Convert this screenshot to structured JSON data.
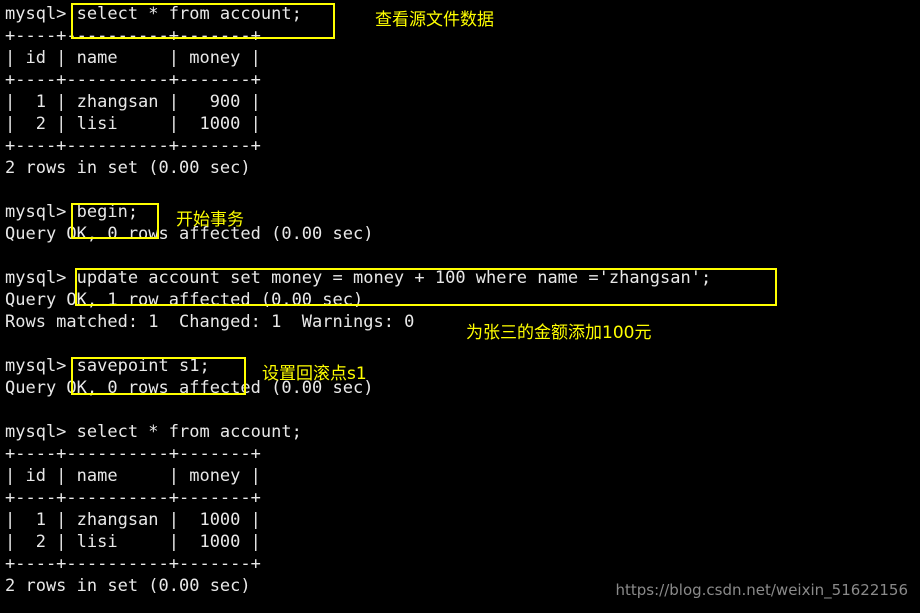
{
  "terminal": {
    "background_color": "#000000",
    "text_color": "#e8e8e8",
    "highlight_color": "#ffff00",
    "prompt": "mysql>",
    "lines": [
      {
        "id": "l0",
        "text": "mysql> select * from account;"
      },
      {
        "id": "l1",
        "text": "+----+----------+-------+"
      },
      {
        "id": "l2",
        "text": "| id | name     | money |"
      },
      {
        "id": "l3",
        "text": "+----+----------+-------+"
      },
      {
        "id": "l4",
        "text": "|  1 | zhangsan |   900 |"
      },
      {
        "id": "l5",
        "text": "|  2 | lisi     |  1000 |"
      },
      {
        "id": "l6",
        "text": "+----+----------+-------+"
      },
      {
        "id": "l7",
        "text": "2 rows in set (0.00 sec)"
      },
      {
        "id": "l8",
        "text": ""
      },
      {
        "id": "l9",
        "text": "mysql> begin;"
      },
      {
        "id": "l10",
        "text": "Query OK, 0 rows affected (0.00 sec)"
      },
      {
        "id": "l11",
        "text": ""
      },
      {
        "id": "l12",
        "text": "mysql> update account set money = money + 100 where name ='zhangsan';"
      },
      {
        "id": "l13",
        "text": "Query OK, 1 row affected (0.00 sec)"
      },
      {
        "id": "l14",
        "text": "Rows matched: 1  Changed: 1  Warnings: 0"
      },
      {
        "id": "l15",
        "text": ""
      },
      {
        "id": "l16",
        "text": "mysql> savepoint s1;"
      },
      {
        "id": "l17",
        "text": "Query OK, 0 rows affected (0.00 sec)"
      },
      {
        "id": "l18",
        "text": ""
      },
      {
        "id": "l19",
        "text": "mysql> select * from account;"
      },
      {
        "id": "l20",
        "text": "+----+----------+-------+"
      },
      {
        "id": "l21",
        "text": "| id | name     | money |"
      },
      {
        "id": "l22",
        "text": "+----+----------+-------+"
      },
      {
        "id": "l23",
        "text": "|  1 | zhangsan |  1000 |"
      },
      {
        "id": "l24",
        "text": "|  2 | lisi     |  1000 |"
      },
      {
        "id": "l25",
        "text": "+----+----------+-------+"
      },
      {
        "id": "l26",
        "text": "2 rows in set (0.00 sec)"
      }
    ]
  },
  "annotations": [
    {
      "id": "a0",
      "text": "查看源文件数据",
      "target": "select * from account;"
    },
    {
      "id": "a1",
      "text": "开始事务",
      "target": "begin;"
    },
    {
      "id": "a2",
      "text": "为张三的金额添加100元",
      "target": "update account set money = money + 100 where name ='zhangsan';"
    },
    {
      "id": "a3",
      "text": "设置回滚点s1",
      "target": "savepoint s1;"
    }
  ],
  "highlights": [
    {
      "id": "h0",
      "command": "select * from account;"
    },
    {
      "id": "h1",
      "command": "begin;"
    },
    {
      "id": "h2",
      "command": "update account set money = money + 100 where name ='zhangsan';"
    },
    {
      "id": "h3",
      "command": "savepoint s1;"
    }
  ],
  "result_tables": [
    {
      "id": "t0",
      "columns": [
        "id",
        "name",
        "money"
      ],
      "rows": [
        [
          "1",
          "zhangsan",
          "900"
        ],
        [
          "2",
          "lisi",
          "1000"
        ]
      ],
      "footer": "2 rows in set (0.00 sec)"
    },
    {
      "id": "t1",
      "columns": [
        "id",
        "name",
        "money"
      ],
      "rows": [
        [
          "1",
          "zhangsan",
          "1000"
        ],
        [
          "2",
          "lisi",
          "1000"
        ]
      ],
      "footer": "2 rows in set (0.00 sec)"
    }
  ],
  "watermark": {
    "text": "https://blog.csdn.net/weixin_51622156"
  }
}
